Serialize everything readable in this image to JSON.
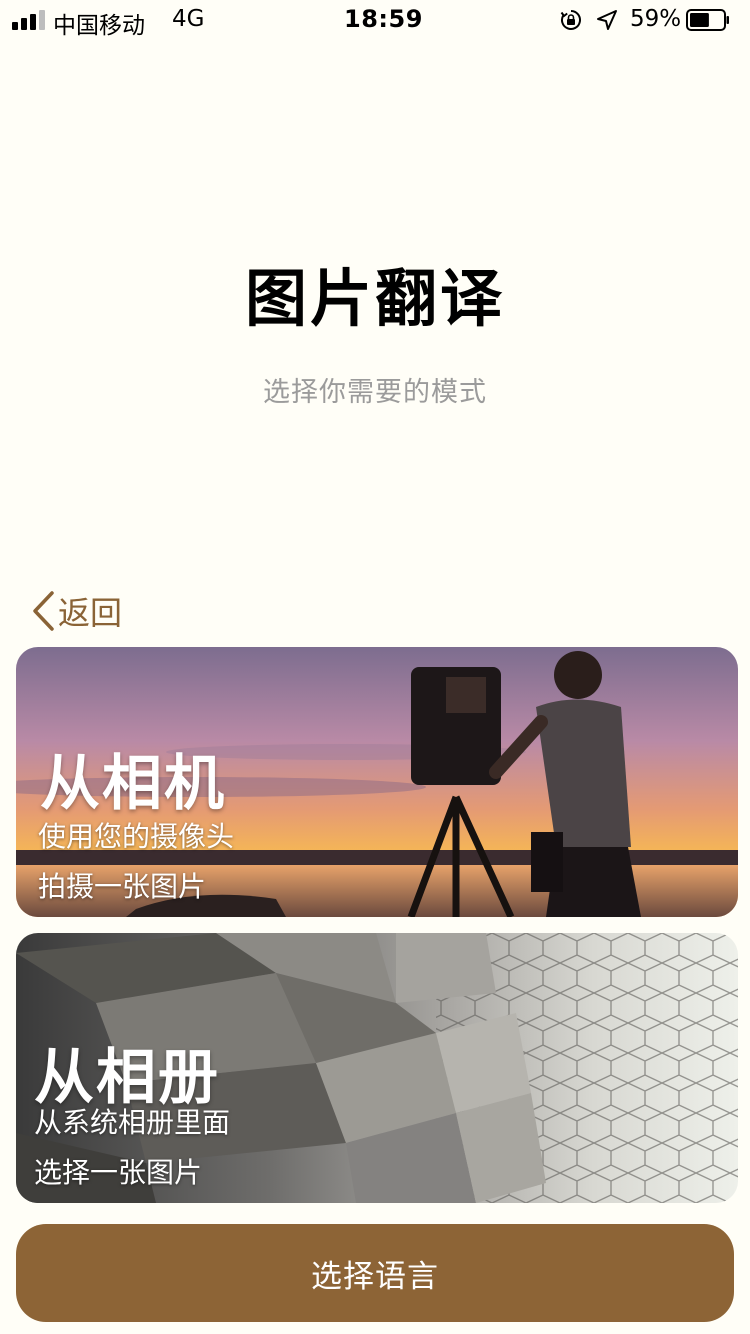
{
  "status_bar": {
    "carrier": "中国移动",
    "network": "4G",
    "time": "18:59",
    "battery_percent": "59%",
    "battery_level": 0.59,
    "signal_bars_active": 3,
    "signal_bars_total": 4,
    "icons": [
      "signal-icon",
      "orientation-lock-icon",
      "location-arrow-icon",
      "battery-icon"
    ]
  },
  "header": {
    "title": "图片翻译",
    "subtitle": "选择你需要的模式"
  },
  "back": {
    "label": "返回",
    "icon": "chevron-left-icon",
    "color": "#8a6336"
  },
  "options": {
    "camera": {
      "title": "从相机",
      "line1": "使用您的摄像头",
      "line2": "拍摄一张图片"
    },
    "album": {
      "title": "从相册",
      "line1": "从系统相册里面",
      "line2": "选择一张图片"
    }
  },
  "bottom_button": {
    "label": "选择语言",
    "color": "#8d6436"
  }
}
